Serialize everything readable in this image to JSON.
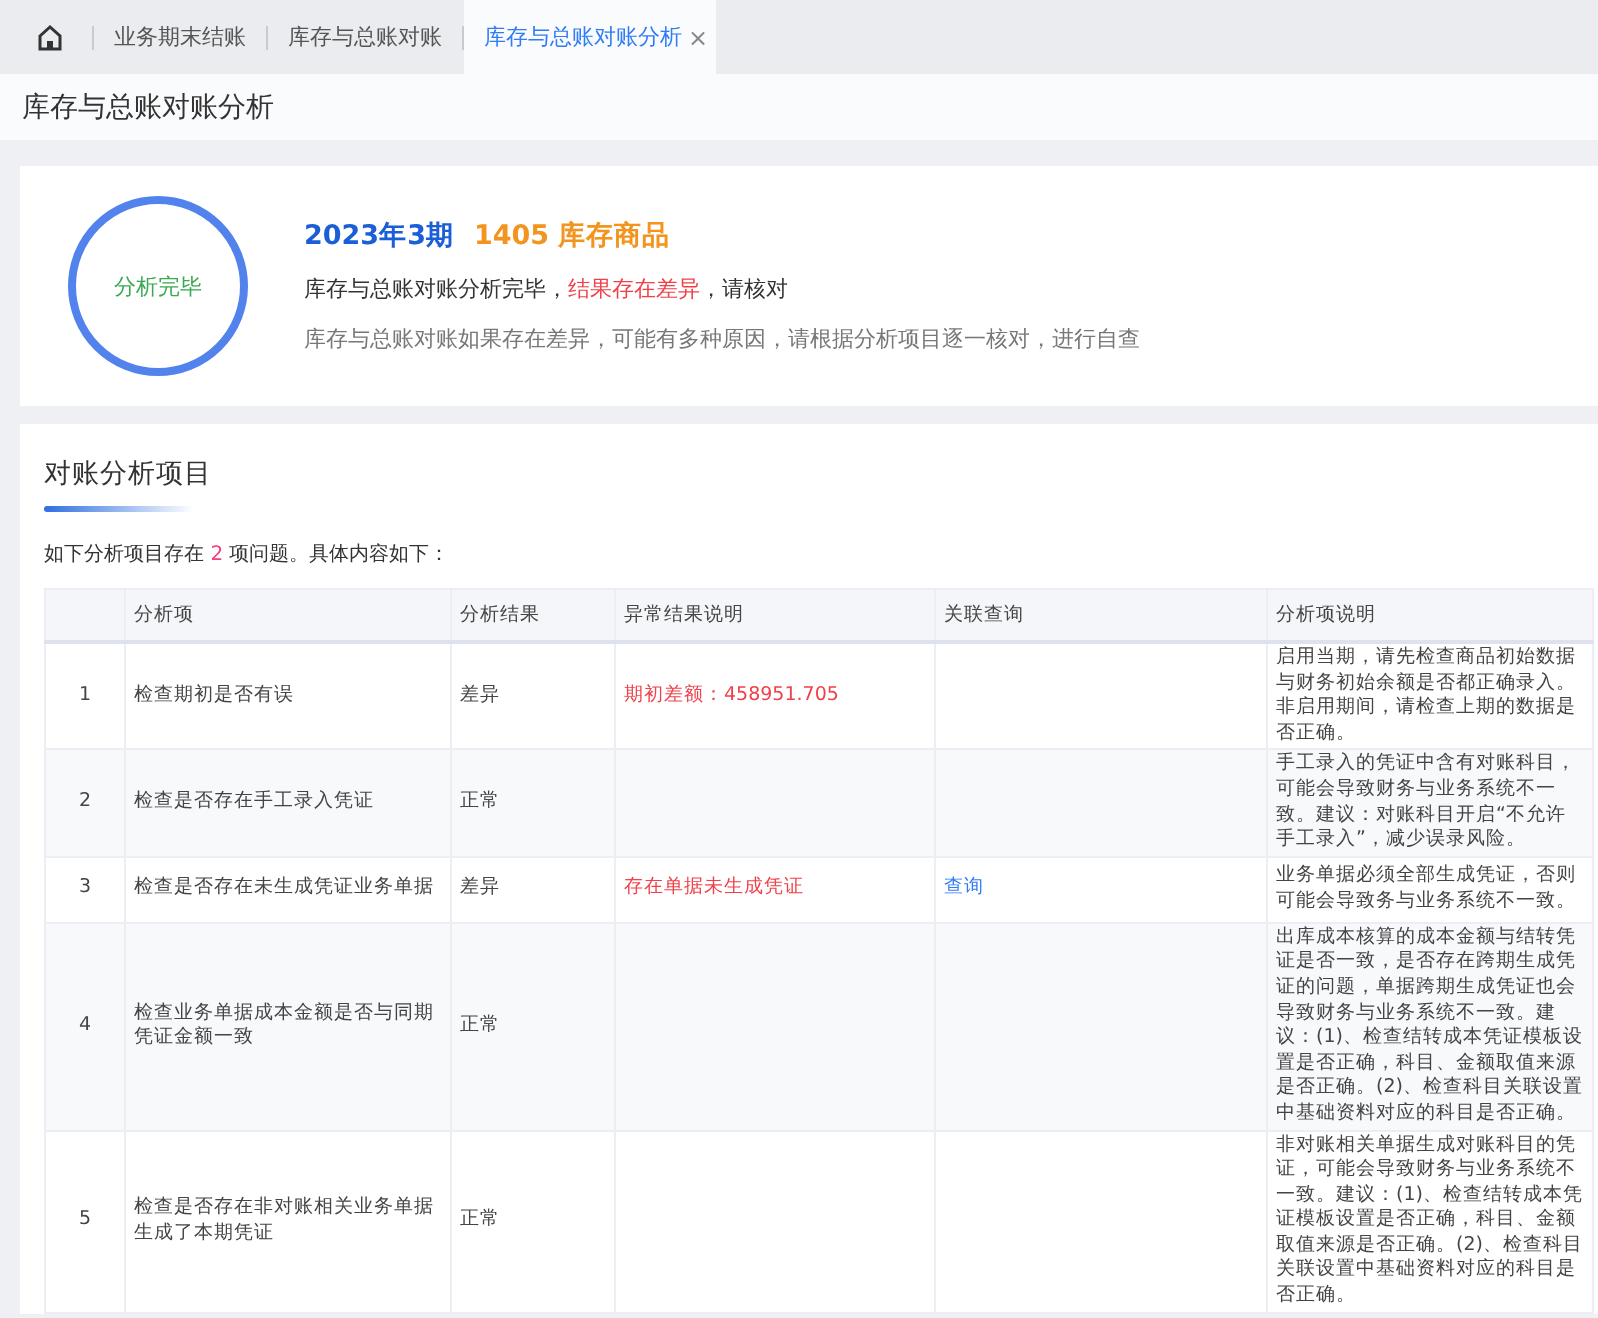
{
  "tabs": [
    {
      "label": "业务期末结账",
      "selected": false
    },
    {
      "label": "库存与总账对账",
      "selected": false
    },
    {
      "label": "库存与总账对账分析",
      "selected": true,
      "close": "×"
    }
  ],
  "page_title": "库存与总账对账分析",
  "summary": {
    "status": "分析完毕",
    "period": "2023年3期",
    "account": "1405 库存商品",
    "message_before": "库存与总账对账分析完毕，",
    "message_highlight": "结果存在差异",
    "message_after": "，请核对",
    "hint": "库存与总账对账如果存在差异，可能有多种原因，请根据分析项目逐一核对，进行自查"
  },
  "section": {
    "title": "对账分析项目",
    "intro_before": "如下分析项目存在",
    "count": "2",
    "intro_after": "项问题。具体内容如下："
  },
  "table": {
    "columns": [
      "分析项",
      "分析结果",
      "异常结果说明",
      "关联查询",
      "分析项说明"
    ],
    "rows": [
      {
        "index": "1",
        "item": "检查期初是否有误",
        "result": "差异",
        "anomaly": "期初差额：458951.705",
        "description": "启用当期，请先检查商品初始数据与财务初始余额是否都正确录入。非启用期间，请检查上期的数据是否正确。"
      },
      {
        "index": "2",
        "item": "检查是否存在手工录入凭证",
        "result": "正常",
        "description": "手工录入的凭证中含有对账科目，可能会导致财务与业务系统不一致。建议：对账科目开启“不允许手工录入”，减少误录风险。"
      },
      {
        "index": "3",
        "item": "检查是否存在未生成凭证业务单据",
        "result": "差异",
        "anomaly": "存在单据未生成凭证",
        "query": "查询",
        "description": "业务单据必须全部生成凭证，否则可能会导致务与业务系统不一致。"
      },
      {
        "index": "4",
        "item": "检查业务单据成本金额是否与同期凭证金额一致",
        "result": "正常",
        "description": "出库成本核算的成本金额与结转凭证是否一致，是否存在跨期生成凭证的问题，单据跨期生成凭证也会导致财务与业务系统不一致。建议：(1)、检查结转成本凭证模板设置是否正确，科目、金额取值来源是否正确。(2)、检查科目关联设置中基础资料对应的科目是否正确。"
      },
      {
        "index": "5",
        "item": "检查是否存在非对账相关业务单据生成了本期凭证",
        "result": "正常",
        "description": "非对账相关单据生成对账科目的凭证，可能会导致财务与业务系统不一致。建议：(1)、检查结转成本凭证模板设置是否正确，科目、金额取值来源是否正确。(2)、检查科目关联设置中基础资料对应的科目是否正确。"
      }
    ]
  }
}
